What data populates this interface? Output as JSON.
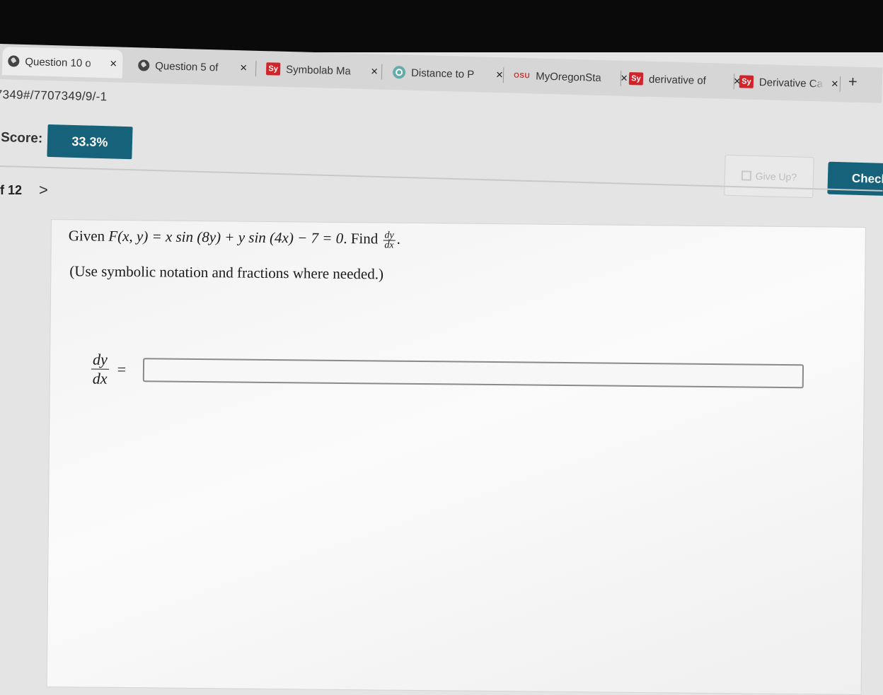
{
  "browser": {
    "tabs": [
      {
        "title": "Question 10 o",
        "icon": "globe-icon",
        "active": true
      },
      {
        "title": "Question 5 of",
        "icon": "globe-icon",
        "active": false
      },
      {
        "title": "Symbolab Ma",
        "icon": "symbolab-icon",
        "active": false
      },
      {
        "title": "Distance to P",
        "icon": "openai-icon",
        "active": false
      },
      {
        "title": "MyOregonSta",
        "icon": "osu-icon",
        "active": false
      },
      {
        "title": "derivative of",
        "icon": "symbolab-icon",
        "active": false
      },
      {
        "title": "Derivative Ca",
        "icon": "symbolab-icon",
        "active": false
      }
    ],
    "symbolab_badge": "Sy",
    "osu_badge": "OSU",
    "new_tab": "+",
    "close_glyph": "×",
    "url": "7349#/7707349/9/-1"
  },
  "score": {
    "label": "Score:",
    "value": "33.3%"
  },
  "actions": {
    "give_up": "Give Up?",
    "check": "Check"
  },
  "nav": {
    "position": "f 12",
    "next": ">"
  },
  "question": {
    "given": "Given ",
    "equation": "F(x, y) = x sin (8y) + y sin (4x) − 7 = 0",
    "find": ". Find ",
    "frac_num": "dy",
    "frac_den": "dx",
    "end": ".",
    "instructions": "(Use symbolic notation and fractions where needed.)"
  },
  "answer": {
    "lhs_num": "dy",
    "lhs_den": "dx",
    "equals": "=",
    "value": ""
  },
  "colors": {
    "accent": "#16627a",
    "symbolab": "#d2232a"
  }
}
